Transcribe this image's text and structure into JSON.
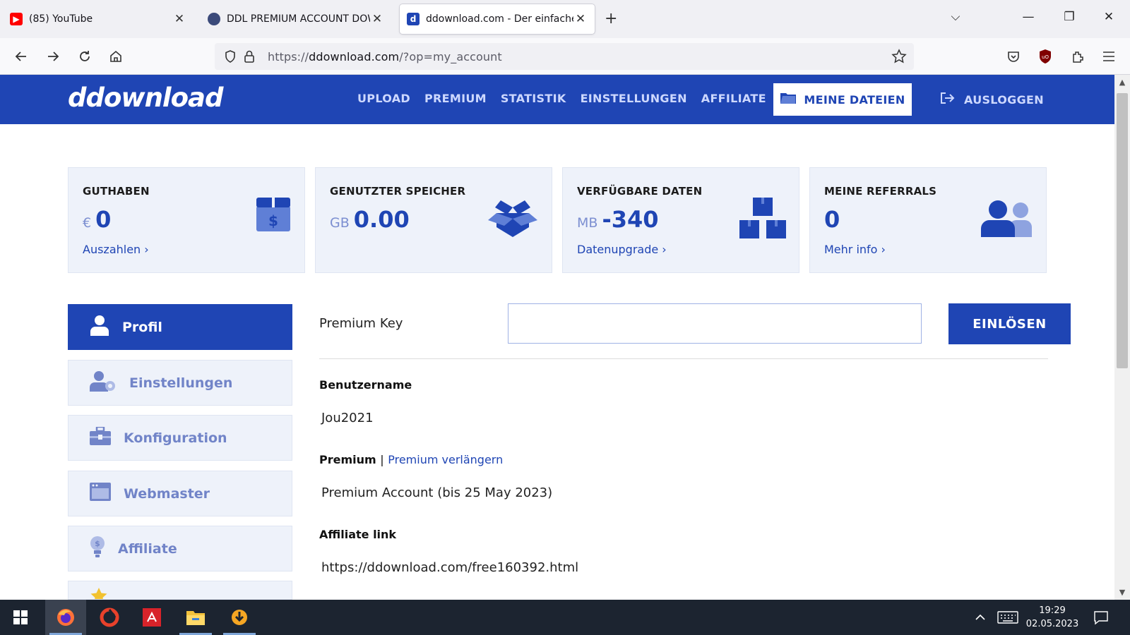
{
  "browser": {
    "tabs": [
      {
        "title": "(85) YouTube",
        "favicon": "youtube-icon",
        "active": false
      },
      {
        "title": "DDL PREMIUM ACCOUNT DOW",
        "favicon": "ddl-site-icon",
        "active": false
      },
      {
        "title": "ddownload.com - Der einfache",
        "favicon": "ddownload-icon",
        "active": true
      }
    ],
    "url_prefix": "https://",
    "url_domain": "ddownload.com",
    "url_path": "/?op=my_account"
  },
  "site": {
    "logo": "ddownload",
    "nav": [
      "UPLOAD",
      "PREMIUM",
      "STATISTIK",
      "EINSTELLUNGEN",
      "AFFILIATE"
    ],
    "my_files": "MEINE DATEIEN",
    "logout": "AUSLOGGEN",
    "brand_color": "#1f45b4"
  },
  "stats": [
    {
      "label": "GUTHABEN",
      "unit": "€",
      "value": "0",
      "link": "Auszahlen",
      "icon": "money-box-icon"
    },
    {
      "label": "GENUTZTER SPEICHER",
      "unit": "GB",
      "value": "0.00",
      "link": "",
      "icon": "open-box-icon"
    },
    {
      "label": "VERFÜGBARE DATEN",
      "unit": "MB",
      "value": "-340",
      "link": "Datenupgrade",
      "icon": "boxes-icon"
    },
    {
      "label": "MEINE REFERRALS",
      "unit": "",
      "value": "0",
      "link": "Mehr info",
      "icon": "users-icon"
    }
  ],
  "menu": [
    {
      "label": "Profil",
      "icon": "user-icon",
      "active": true
    },
    {
      "label": "Einstellungen",
      "icon": "user-settings-icon",
      "active": false
    },
    {
      "label": "Konfiguration",
      "icon": "toolbox-icon",
      "active": false
    },
    {
      "label": "Webmaster",
      "icon": "browser-window-icon",
      "active": false
    },
    {
      "label": "Affiliate",
      "icon": "lightbulb-dollar-icon",
      "active": false
    }
  ],
  "profile": {
    "premium_key_label": "Premium Key",
    "premium_key_value": "",
    "redeem_button": "EINLÖSEN",
    "username_label": "Benutzername",
    "username": "Jou2021",
    "premium_label": "Premium",
    "premium_separator": "|",
    "premium_extend_link": "Premium verlängern",
    "premium_status": "Premium Account (bis 25 May 2023)",
    "affiliate_label": "Affiliate link",
    "affiliate_url": "https://ddownload.com/free160392.html"
  },
  "taskbar": {
    "time": "19:29",
    "date": "02.05.2023"
  }
}
